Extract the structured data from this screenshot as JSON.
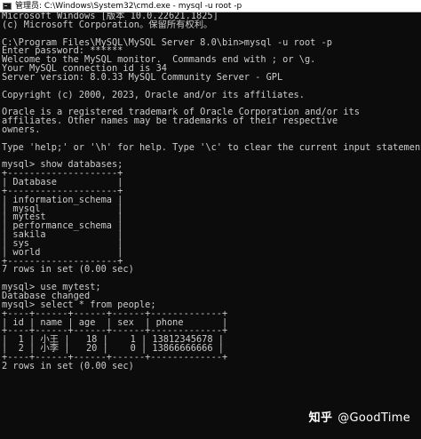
{
  "window": {
    "title": "管理员: C:\\Windows\\System32\\cmd.exe - mysql  -u root -p"
  },
  "console": {
    "lines": [
      "Microsoft Windows [版本 10.0.22621.1825]",
      "(c) Microsoft Corporation。保留所有权利。",
      "",
      "C:\\Program Files\\MySQL\\MySQL Server 8.0\\bin>mysql -u root -p",
      "Enter password: ******",
      "Welcome to the MySQL monitor.  Commands end with ; or \\g.",
      "Your MySQL connection id is 34",
      "Server version: 8.0.33 MySQL Community Server - GPL",
      "",
      "Copyright (c) 2000, 2023, Oracle and/or its affiliates.",
      "",
      "Oracle is a registered trademark of Oracle Corporation and/or its",
      "affiliates. Other names may be trademarks of their respective",
      "owners.",
      "",
      "Type 'help;' or '\\h' for help. Type '\\c' to clear the current input statement.",
      "",
      "mysql> show databases;",
      "+--------------------+",
      "| Database           |",
      "+--------------------+",
      "| information_schema |",
      "| mysql              |",
      "| mytest             |",
      "| performance_schema |",
      "| sakila             |",
      "| sys                |",
      "| world              |",
      "+--------------------+",
      "7 rows in set (0.00 sec)",
      "",
      "mysql> use mytest;",
      "Database changed",
      "mysql> select * from people;",
      "+----+------+------+------+-------------+",
      "| id | name | age  | sex  | phone       |",
      "+----+------+------+------+-------------+",
      "|  1 | 小王 |   18 |    1 | 13812345678 |",
      "|  2 | 小李 |   20 |    0 | 13866666666 |",
      "+----+------+------+------+-------------+",
      "2 rows in set (0.00 sec)"
    ]
  },
  "watermark": {
    "logo": "知乎",
    "handle": "@GoodTime"
  }
}
